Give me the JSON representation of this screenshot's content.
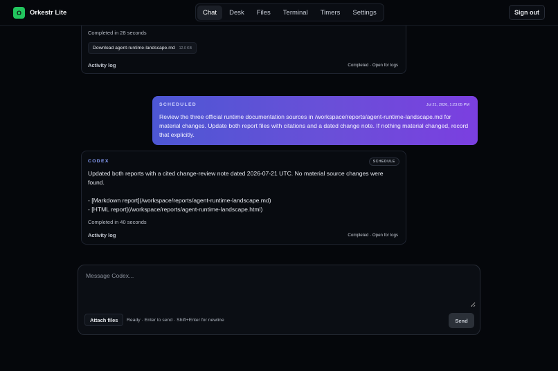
{
  "app": {
    "logo_letter": "O",
    "name": "Orkestr Lite"
  },
  "nav": {
    "tabs": [
      {
        "label": "Chat",
        "active": true
      },
      {
        "label": "Desk"
      },
      {
        "label": "Files"
      },
      {
        "label": "Terminal"
      },
      {
        "label": "Timers"
      },
      {
        "label": "Settings"
      }
    ],
    "sign_out": "Sign out"
  },
  "messages": {
    "first": {
      "completed": "Completed in 28 seconds",
      "download_label": "Download agent-runtime-landscape.md",
      "download_size": "12.0 KB",
      "activity_log": "Activity log",
      "status": "Completed · Open for logs"
    },
    "user": {
      "label": "SCHEDULED",
      "timestamp": "Jul 21, 2026, 1:23:05 PM",
      "text": "Review the three official runtime documentation sources in /workspace/reports/agent-runtime-landscape.md for material changes. Update both report files with citations and a dated change note. If nothing material changed, record that explicitly."
    },
    "second": {
      "label": "CODEX",
      "badge": "SCHEDULE",
      "paragraph": "Updated both reports with a cited change-review note dated 2026-07-21 UTC. No material source changes were found.",
      "line1": "- [Markdown report](/workspace/reports/agent-runtime-landscape.md)",
      "line2": "- [HTML report](/workspace/reports/agent-runtime-landscape.html)",
      "completed": "Completed in 40 seconds",
      "activity_log": "Activity log",
      "status": "Completed · Open for logs"
    }
  },
  "composer": {
    "placeholder": "Message Codex...",
    "attach": "Attach files",
    "status": "Ready · Enter to send · Shift+Enter for newline",
    "send": "Send"
  }
}
